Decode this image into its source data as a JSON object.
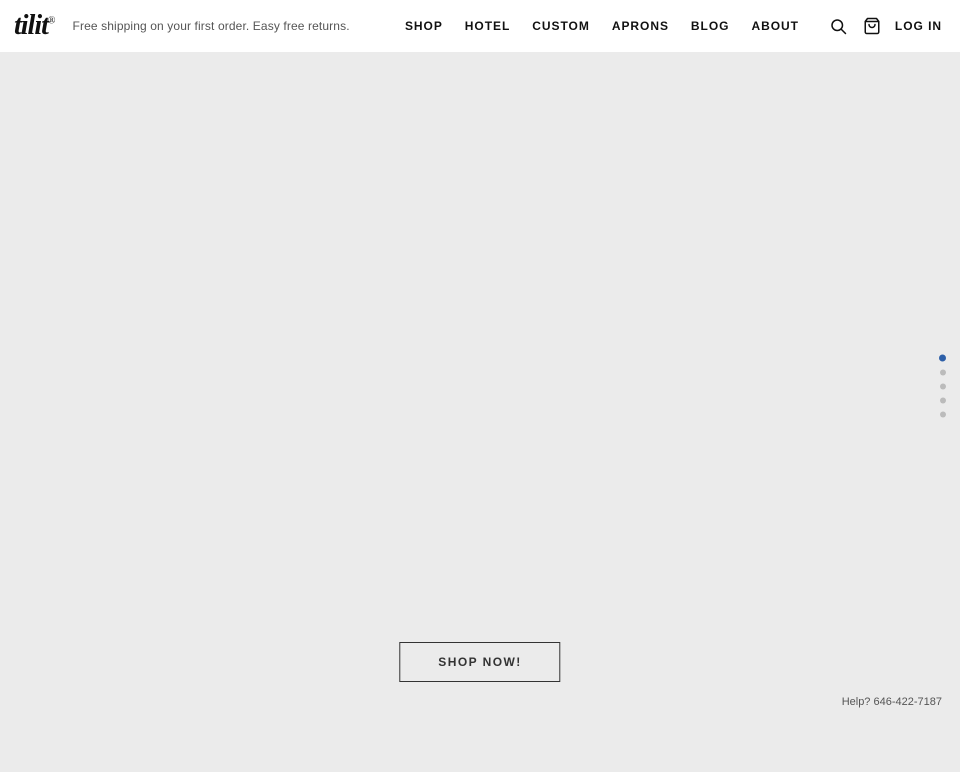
{
  "header": {
    "logo": {
      "text": "tilit",
      "reg_symbol": "®"
    },
    "tagline": "Free shipping on your first order. Easy free returns.",
    "nav": {
      "items": [
        {
          "label": "SHOP",
          "id": "shop"
        },
        {
          "label": "HOTEL",
          "id": "hotel"
        },
        {
          "label": "CUSTOM",
          "id": "custom"
        },
        {
          "label": "APRONS",
          "id": "aprons"
        },
        {
          "label": "BLOG",
          "id": "blog"
        },
        {
          "label": "ABOUT",
          "id": "about"
        }
      ],
      "log_in": "LOG IN"
    }
  },
  "main": {
    "cta_button": "SHOP NOW!",
    "help_text": "Help? 646-422-7187"
  },
  "slide_dots": {
    "count": 5,
    "active_index": 0
  }
}
